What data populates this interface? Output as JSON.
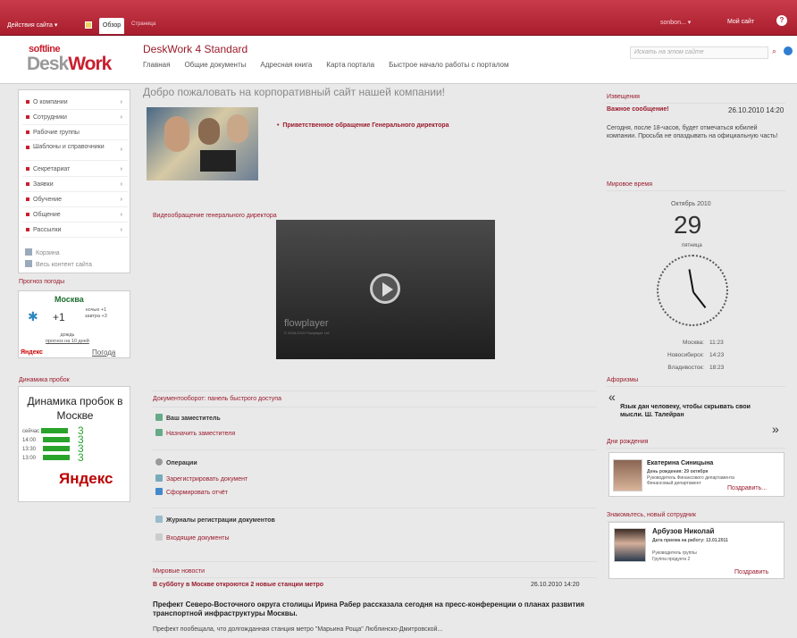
{
  "ribbon": {
    "site_actions": "Действия сайта ▾",
    "tab_browse": "Обзор",
    "tab_page": "Страница",
    "user": "sonbon... ▾",
    "my_site": "Мой сайт"
  },
  "header": {
    "logo_top": "softline",
    "logo_desk": "Desk",
    "logo_work": "Work",
    "site_title": "DeskWork 4 Standard",
    "nav": [
      "Главная",
      "Общие документы",
      "Адресная книга",
      "Карта портала",
      "Быстрое начало работы с порталом"
    ],
    "search_placeholder": "Искать на этом сайте"
  },
  "leftnav": {
    "items": [
      "О компании",
      "Сотрудники",
      "Рабочие группы",
      "Шаблоны и справочники",
      "Секретариат",
      "Заявки",
      "Обучение",
      "Общение",
      "Рассылки"
    ],
    "recycle": "Корзина",
    "all_content": "Весь контент сайта"
  },
  "weather": {
    "label": "Прогноз погоды",
    "city": "Москва",
    "temp": "+1",
    "night": "ночью +1",
    "tomorrow": "завтра +3",
    "rain": "дождь",
    "forecast_link": "прогноз на 10 дней",
    "yandex": "Яндекс",
    "weather_link": "Погода"
  },
  "traffic": {
    "label": "Динамика пробок",
    "title": "Динамика пробок в Москве",
    "rows": [
      {
        "time": "сейчас",
        "level": "3"
      },
      {
        "time": "14:00",
        "level": "3"
      },
      {
        "time": "13:30",
        "level": "3"
      },
      {
        "time": "13:00",
        "level": "3"
      }
    ],
    "yandex": "Яндекс"
  },
  "main": {
    "heading": "Добро пожаловать на корпоративный сайт нашей компании!",
    "greeting_link": "Приветственное обращение Генерального директора",
    "video_label": "Видеообращение генерального директора",
    "flowplayer": "flowplayer",
    "flowplayer_sub": "© 2008-2010 Flowplayer Ltd",
    "qa_title": "Документооборот: панель быстрого доступа",
    "qa_deputy": "Ваш заместитель",
    "qa_assign": "Назначить заместителя",
    "qa_ops": "Операции",
    "qa_register": "Зарегистрировать документ",
    "qa_report": "Сформировать отчёт",
    "qa_journals": "Журналы регистрации документов",
    "qa_incoming": "Входящие документы",
    "news_title": "Мировые новости",
    "news_head": "В субботу в Москве откроются 2 новые станции метро",
    "news_date": "26.10.2010 14:20",
    "news_lead": "Префект Северо-Восточного округа столицы Ирина Рабер рассказала сегодня на пресс-конференции о планах развития транспортной инфраструктуры Москвы.",
    "news_body": "Префект пообещала, что долгожданная станция метро \"Марьина Роща\" Люблинско-Дмитровской..."
  },
  "right": {
    "ann_title": "Извещения",
    "ann_head": "Важное сообщение!",
    "ann_date": "26.10.2010 14:20",
    "ann_body": "Сегодня, после 18-часов, будет отмечаться юбилей компании. Просьба не опаздывать на официальную часть!",
    "time_title": "Мировое время",
    "month": "Октябрь 2010",
    "day": "29",
    "weekday": "пятница",
    "zones": [
      {
        "city": "Москва:",
        "time": "11:23"
      },
      {
        "city": "Новосибирск:",
        "time": "14:23"
      },
      {
        "city": "Владивосток:",
        "time": "18:23"
      }
    ],
    "aph_title": "Афоризмы",
    "quote": "Язык дан человеку, чтобы скрывать свои мысли. Ш. Талейран",
    "bday_title": "Дни рождения",
    "bday_name": "Екатерина Синицына",
    "bday_date": "День рождения: 29 октября",
    "bday_pos": "Руководитель Финансового департамента",
    "bday_dept": "Финансовый департамент",
    "bday_btn": "Поздравить...",
    "new_title": "Знакомьтесь, новый сотрудник",
    "new_name": "Арбузов Николай",
    "new_date": "Дата приема на работу: 13.01.2011",
    "new_pos": "Руководитель группы",
    "new_group": "Группа продукта 2",
    "new_btn": "Поздравить"
  }
}
